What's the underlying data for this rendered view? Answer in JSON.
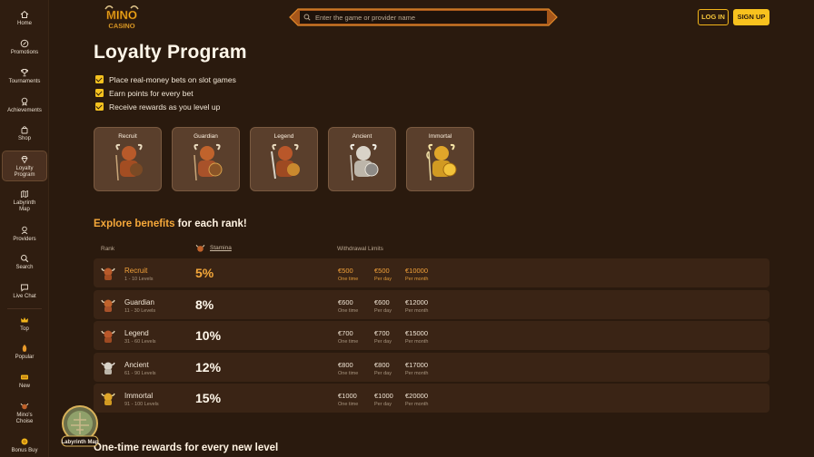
{
  "sidebar": {
    "items": [
      {
        "label": "Home",
        "icon": "home-icon"
      },
      {
        "label": "Promotions",
        "icon": "promotions-icon"
      },
      {
        "label": "Tournaments",
        "icon": "trophy-icon"
      },
      {
        "label": "Achievements",
        "icon": "medal-icon"
      },
      {
        "label": "Shop",
        "icon": "shop-bag-icon"
      },
      {
        "label": "Loyalty",
        "label2": "Program",
        "icon": "diamond-icon"
      },
      {
        "label": "Labyrinth",
        "label2": "Map",
        "icon": "map-icon"
      },
      {
        "label": "Providers",
        "icon": "providers-icon"
      },
      {
        "label": "Search",
        "icon": "search-icon"
      },
      {
        "label": "Live Chat",
        "icon": "chat-icon"
      },
      {
        "label": "Top",
        "icon": "crown-icon"
      },
      {
        "label": "Popular",
        "icon": "popular-icon"
      },
      {
        "label": "New",
        "icon": "new-icon"
      },
      {
        "label": "Mino's",
        "label2": "Choise",
        "icon": "mino-icon"
      },
      {
        "label": "Bonus Buy",
        "icon": "bonus-buy-icon"
      }
    ]
  },
  "header": {
    "logo_line1": "MINO",
    "logo_line2": "CASINO",
    "search_placeholder": "Enter the game or provider name",
    "login_label": "LOG IN",
    "signup_label": "SIGN UP"
  },
  "page": {
    "title": "Loyalty Program",
    "checklist": [
      "Place real-money bets on slot games",
      "Earn points for every bet",
      "Receive rewards as you level up"
    ],
    "rank_cards": [
      "Recruit",
      "Guardian",
      "Legend",
      "Ancient",
      "Immortal"
    ],
    "explore_accent": "Explore benefits",
    "explore_rest": "for each rank!",
    "table_headers": {
      "rank": "Rank",
      "stamina": "Stamina",
      "withdrawal": "Withdrawal Limits"
    },
    "rows": [
      {
        "name": "Recruit",
        "levels": "1 - 10 Levels",
        "stamina": "5%",
        "one_time": "€500",
        "per_day": "€500",
        "per_month": "€10000"
      },
      {
        "name": "Guardian",
        "levels": "11 - 30 Levels",
        "stamina": "8%",
        "one_time": "€600",
        "per_day": "€600",
        "per_month": "€12000"
      },
      {
        "name": "Legend",
        "levels": "31 - 60 Levels",
        "stamina": "10%",
        "one_time": "€700",
        "per_day": "€700",
        "per_month": "€15000"
      },
      {
        "name": "Ancient",
        "levels": "61 - 90 Levels",
        "stamina": "12%",
        "one_time": "€800",
        "per_day": "€800",
        "per_month": "€17000"
      },
      {
        "name": "Immortal",
        "levels": "91 - 100 Levels",
        "stamina": "15%",
        "one_time": "€1000",
        "per_day": "€1000",
        "per_month": "€20000"
      }
    ],
    "limit_labels": {
      "one_time": "One time",
      "per_day": "Per day",
      "per_month": "Per month"
    },
    "one_time_heading": "One-time rewards for every new level",
    "badge_label": "Labyrinth Map"
  },
  "colors": {
    "accent": "#f5a83a",
    "gold": "#f8c21e",
    "background": "#2a1a0e"
  }
}
